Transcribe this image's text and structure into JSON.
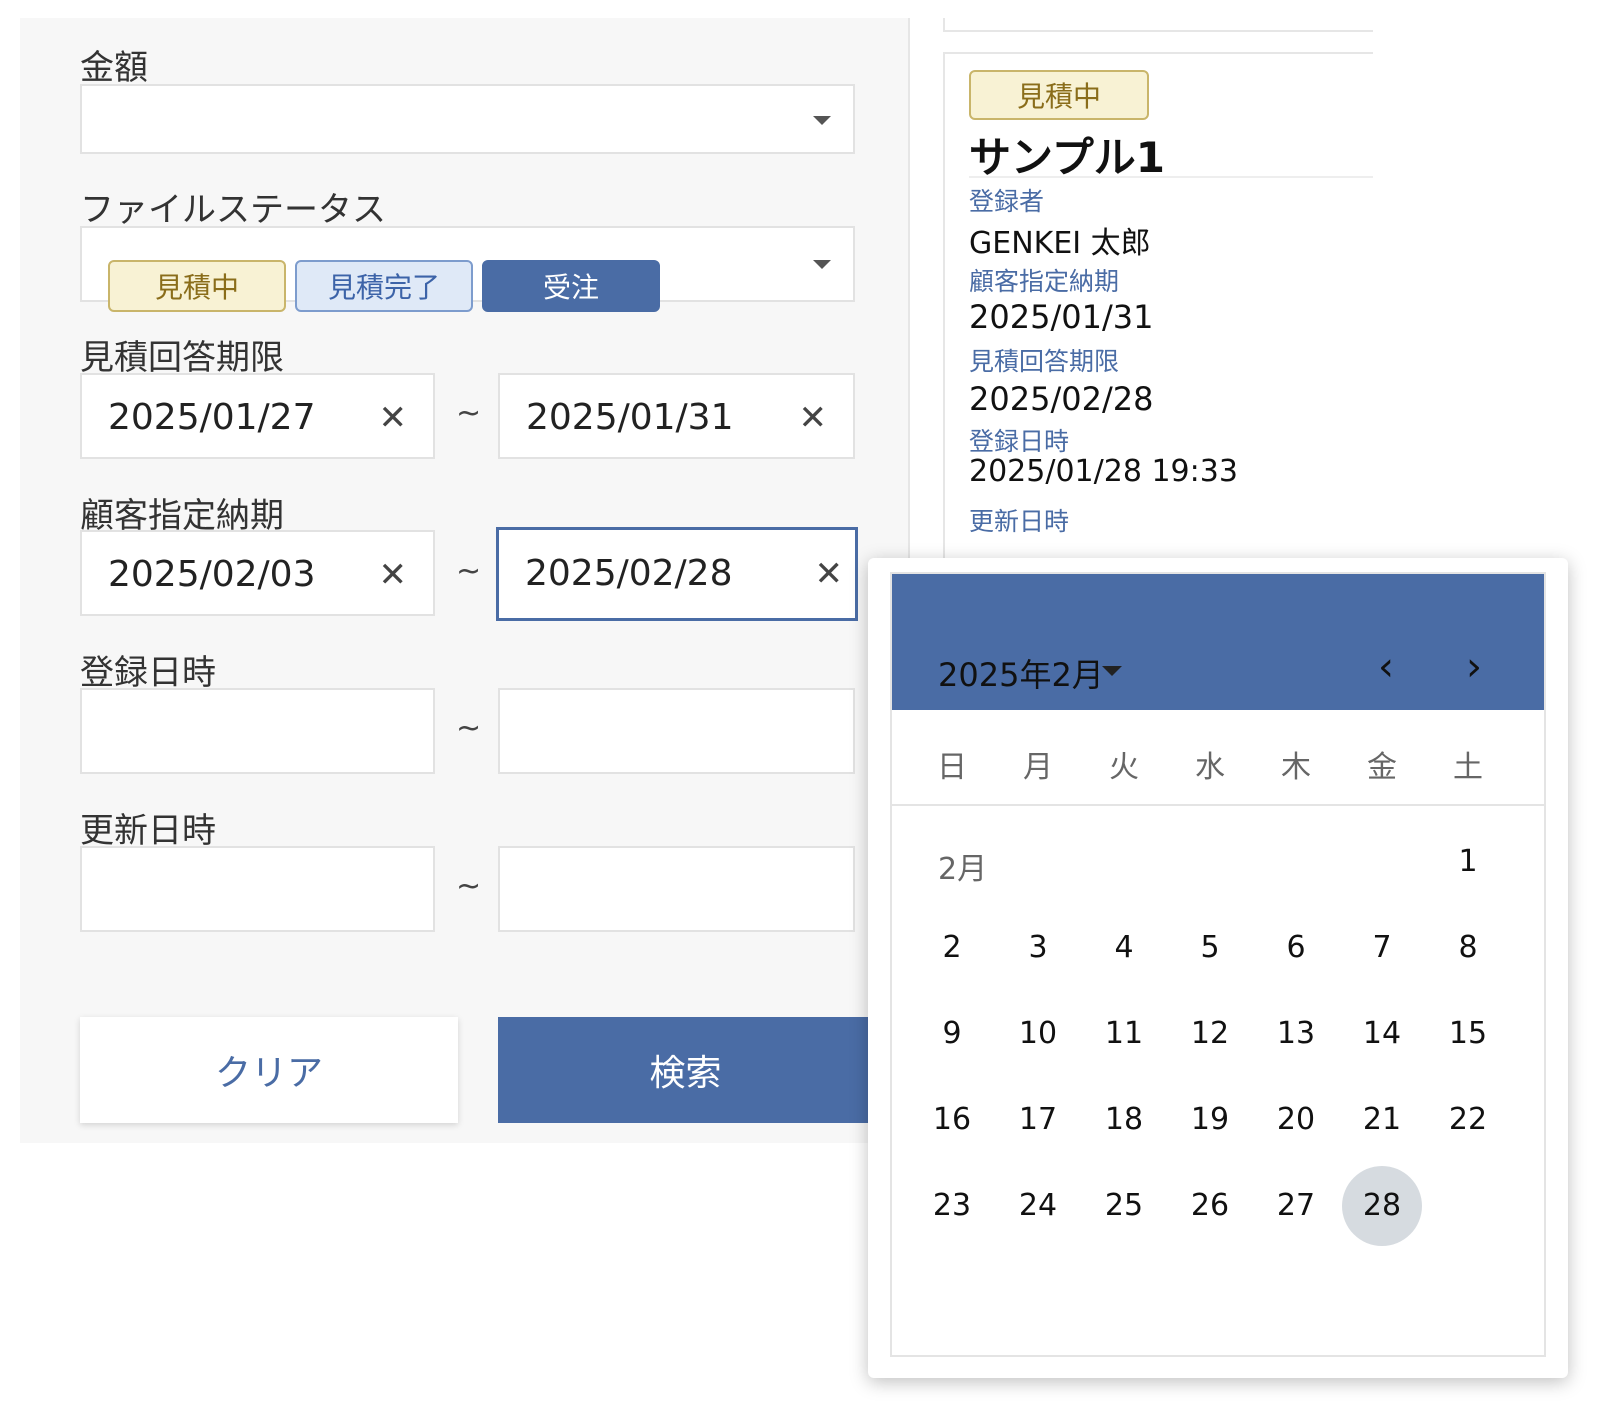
{
  "filters": {
    "amount": {
      "label": "金額",
      "value": ""
    },
    "file_status": {
      "label": "ファイルステータス",
      "chips": [
        "見積中",
        "見積完了",
        "受注"
      ]
    },
    "quote_deadline": {
      "label": "見積回答期限",
      "from": "2025/01/27",
      "to": "2025/01/31"
    },
    "customer_due": {
      "label": "顧客指定納期",
      "from": "2025/02/03",
      "to": "2025/02/28"
    },
    "registered_at": {
      "label": "登録日時",
      "from": "",
      "to": ""
    },
    "updated_at": {
      "label": "更新日時",
      "from": "",
      "to": ""
    },
    "range_sep": "~",
    "clear_glyph": "✕",
    "clear_button": "クリア",
    "search_button": "検索"
  },
  "detail": {
    "status": "見積中",
    "title": "サンプル1",
    "registrant_label": "登録者",
    "registrant": "GENKEI 太郎",
    "customer_due_label": "顧客指定納期",
    "customer_due": "2025/01/31",
    "quote_deadline_label": "見積回答期限",
    "quote_deadline": "2025/02/28",
    "registered_at_label": "登録日時",
    "registered_at": "2025/01/28 19:33",
    "updated_at_label": "更新日時"
  },
  "datepicker": {
    "month_label": "2025年2月",
    "prev": "‹",
    "next": "›",
    "weekdays": [
      "日",
      "月",
      "火",
      "水",
      "木",
      "金",
      "土"
    ],
    "mini_month": "2月",
    "days": [
      "1",
      "2",
      "3",
      "4",
      "5",
      "6",
      "7",
      "8",
      "9",
      "10",
      "11",
      "12",
      "13",
      "14",
      "15",
      "16",
      "17",
      "18",
      "19",
      "20",
      "21",
      "22",
      "23",
      "24",
      "25",
      "26",
      "27",
      "28"
    ],
    "selected_day": "28"
  },
  "colors": {
    "accent": "#4a6ca5",
    "estimating_bg": "#f8f2d4",
    "estimate_done_bg": "#dfe9f7",
    "selected_day_bg": "#d6dbe0"
  }
}
